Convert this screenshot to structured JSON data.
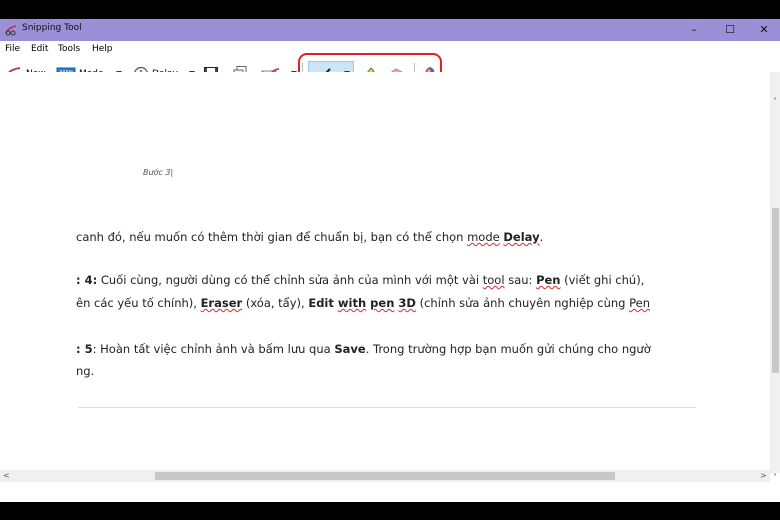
{
  "window": {
    "title": "Snipping Tool",
    "minimize": "–",
    "maximize": "☐",
    "close": "✕"
  },
  "menu": {
    "file": "File",
    "edit": "Edit",
    "tools": "Tools",
    "help": "Help"
  },
  "toolbar": {
    "new_label": "New",
    "mode_label": "Mode",
    "delay_label": "Delay",
    "icons": [
      "new-snip-icon",
      "mode-icon",
      "delay-clock-icon",
      "save-icon",
      "copy-icon",
      "send-email-icon",
      "pen-icon",
      "highlighter-icon",
      "eraser-icon",
      "paint3d-icon"
    ]
  },
  "colors": {
    "titlebar": "#9a90d8",
    "highlight": "#e02020",
    "pen_active": "#cce4f7"
  },
  "document": {
    "caption": "Bước 3|",
    "p1": {
      "a": "canh đó, nếu muốn có thêm thời gian để chuẩn bị, bạn có thể chọn ",
      "b": "mode",
      "c": " ",
      "d": "Delay",
      "e": "."
    },
    "p2": {
      "a": ": 4:",
      "b": " Cuối cùng, người dùng có thể chỉnh sửa ảnh của mình với một vài ",
      "c": "tool",
      "d": " sau: ",
      "e": "Pen",
      "f": " (viết ghi chú), "
    },
    "p3": {
      "a": "ên các yếu tố chính), ",
      "b": "Eraser",
      "c": " (xóa, tẩy), ",
      "d": "Edit",
      "e": " ",
      "f": "with",
      "g": " ",
      "h": "pen",
      "i": " ",
      "j": "3D",
      "k": " (chỉnh sửa ảnh chuyên nghiệp cùng ",
      "l": "Pen"
    },
    "p4": {
      "a": ": 5",
      "b": ": Hoàn tất việc chỉnh ảnh và bấm lưu qua ",
      "c": "Save",
      "d": ". Trong trường hợp bạn muốn gửi chúng cho ngườ"
    },
    "p5": "ng."
  }
}
